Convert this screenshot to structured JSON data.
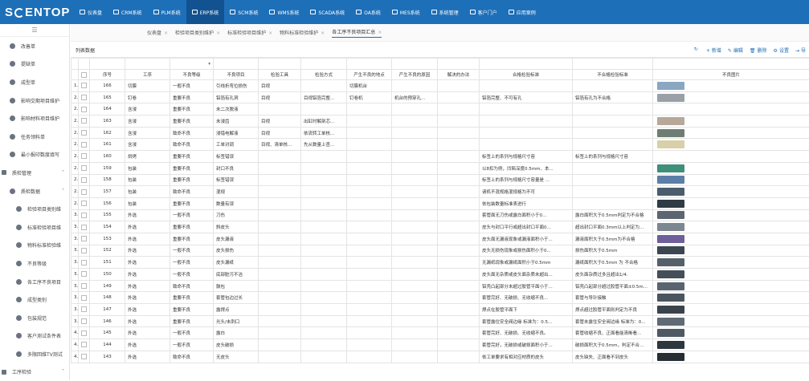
{
  "app": {
    "logo": "SCIENTOP"
  },
  "topnav": [
    {
      "label": "仪表盘",
      "active": false
    },
    {
      "label": "CRM系统",
      "active": false
    },
    {
      "label": "PLM系统",
      "active": false
    },
    {
      "label": "ERP系统",
      "active": true
    },
    {
      "label": "SCM系统",
      "active": false
    },
    {
      "label": "WMS系统",
      "active": false
    },
    {
      "label": "SCADA系统",
      "active": false
    },
    {
      "label": "OA系统",
      "active": false
    },
    {
      "label": "MES系统",
      "active": false
    },
    {
      "label": "系统管理",
      "active": false
    },
    {
      "label": "客户门户",
      "active": false
    },
    {
      "label": "应用案例",
      "active": false
    }
  ],
  "sidebar": {
    "items": [
      {
        "label": "改善单",
        "level": "lvl2"
      },
      {
        "label": "提缺单",
        "level": "lvl2"
      },
      {
        "label": "成型单",
        "level": "lvl2"
      },
      {
        "label": "影响交期项目维护",
        "level": "lvl2"
      },
      {
        "label": "影响材料项目维护",
        "level": "lvl2"
      },
      {
        "label": "任务领料单",
        "level": "lvl2"
      },
      {
        "label": "最小报印数度填写",
        "level": "lvl2"
      },
      {
        "label": "质检管理",
        "level": "lvl1",
        "arrow": "˅"
      },
      {
        "label": "质检数据",
        "level": "lvl2",
        "arrow": "˅"
      },
      {
        "label": "检验项目类别维",
        "level": "lvl3"
      },
      {
        "label": "标准检验项目维",
        "level": "lvl3"
      },
      {
        "label": "物料标准检验维",
        "level": "lvl3"
      },
      {
        "label": "不良等级",
        "level": "lvl3"
      },
      {
        "label": "各工序不良项目",
        "level": "lvl3"
      },
      {
        "label": "成型类别",
        "level": "lvl3"
      },
      {
        "label": "包装规范",
        "level": "lvl3"
      },
      {
        "label": "客户测试条件表",
        "level": "lvl3"
      },
      {
        "label": "多限回维TV测试",
        "level": "lvl3"
      },
      {
        "label": "工序检验",
        "level": "lvl1",
        "arrow": "˅"
      }
    ]
  },
  "tabs": [
    {
      "label": "仪表盘",
      "active": false
    },
    {
      "label": "检验项目类别维护",
      "active": false
    },
    {
      "label": "标准检验项目维护",
      "active": false
    },
    {
      "label": "物料标准检验维护",
      "active": false
    },
    {
      "label": "各工序不良项目汇总",
      "active": true
    }
  ],
  "panel": {
    "title": "列表数据",
    "tools": [
      {
        "icon": "↻",
        "label": ""
      },
      {
        "icon": "+",
        "label": "新增"
      },
      {
        "icon": "✎",
        "label": "编辑"
      },
      {
        "icon": "🗑",
        "label": "删除"
      },
      {
        "icon": "⚙",
        "label": "设置"
      },
      {
        "icon": "⇥",
        "label": "导"
      }
    ]
  },
  "table": {
    "columns": [
      "序号",
      "工序",
      "不良等级",
      "不良项目",
      "检验工具",
      "检验方式",
      "产生不良的地点",
      "产生不良的原因",
      "解决的办法",
      "合格检验标准",
      "不合格检验标准",
      "不良图片"
    ],
    "rows": [
      {
        "n": "19",
        "seq": "166",
        "proc": "切膜",
        "level": "一般不良",
        "item": "引线折弯位损伤",
        "tool": "目视",
        "method": "",
        "place": "切膜机台",
        "cause": "",
        "fix": "",
        "ok": "",
        "ng": "",
        "img": "#8aa6c1"
      },
      {
        "n": "20",
        "seq": "165",
        "proc": "钉卷",
        "level": "重要不良",
        "item": "铝箔有孔洞",
        "tool": "目视",
        "method": "目视铝箔完整...",
        "place": "钉卷机",
        "cause": "机台的预穿孔...",
        "fix": "",
        "ok": "铝箔完整、不可有孔",
        "ng": "铝箔有孔为不合格",
        "img": "#9aa0a6"
      },
      {
        "n": "21",
        "seq": "164",
        "proc": "含浸",
        "level": "重要不良",
        "item": "未二次脱液",
        "tool": "",
        "method": "",
        "place": "",
        "cause": "",
        "fix": "",
        "ok": "",
        "ng": "",
        "img": ""
      },
      {
        "n": "22",
        "seq": "163",
        "proc": "含浸",
        "level": "重要不良",
        "item": "未浸齿",
        "tool": "目视",
        "method": "出缸时解剖芯...",
        "place": "",
        "cause": "",
        "fix": "",
        "ok": "",
        "ng": "",
        "img": "#b7a89a"
      },
      {
        "n": "23",
        "seq": "162",
        "proc": "含浸",
        "level": "致命不良",
        "item": "浸错电解液",
        "tool": "目视",
        "method": "依流转工单核...",
        "place": "",
        "cause": "",
        "fix": "",
        "ok": "",
        "ng": "",
        "img": "#6f7e74",
        "sel": true
      },
      {
        "n": "24",
        "seq": "161",
        "proc": "含浸",
        "level": "致命不良",
        "item": "工单对调",
        "tool": "目视、清单核...",
        "method": "先从数量上查...",
        "place": "",
        "cause": "",
        "fix": "",
        "ok": "",
        "ng": "",
        "img": "#d9cfa8"
      },
      {
        "n": "25",
        "seq": "160",
        "proc": "烘烤",
        "level": "重要不良",
        "item": "标签错误",
        "tool": "",
        "method": "",
        "place": "",
        "cause": "",
        "fix": "",
        "ok": "标签上的系列与规格尺寸容",
        "ng": "标签上的系列与规格尺寸容",
        "img": ""
      },
      {
        "n": "26",
        "seq": "159",
        "proc": "包装",
        "level": "重要不良",
        "item": "封口不良",
        "tool": "",
        "method": "",
        "place": "",
        "cause": "",
        "fix": "",
        "ok": "以8扣为例，凹陷深度0.5mm、本...",
        "ng": "",
        "img": "#3f8f7a"
      },
      {
        "n": "27",
        "seq": "158",
        "proc": "包装",
        "level": "重要不良",
        "item": "标签错误",
        "tool": "",
        "method": "",
        "place": "",
        "cause": "",
        "fix": "",
        "ok": "标签上的系列与规格尺寸容量是 ...",
        "ng": "",
        "img": "#5b7fa8"
      },
      {
        "n": "28",
        "seq": "157",
        "proc": "包装",
        "level": "致命不良",
        "item": "混规",
        "tool": "",
        "method": "",
        "place": "",
        "cause": "",
        "fix": "",
        "ok": "请机不混规格混规格为不可",
        "ng": "",
        "img": "#4a5d6e"
      },
      {
        "n": "29",
        "seq": "156",
        "proc": "包装",
        "level": "重要不良",
        "item": "数量有误",
        "tool": "",
        "method": "",
        "place": "",
        "cause": "",
        "fix": "",
        "ok": "依包装数量标准表进行",
        "ng": "",
        "img": "#2f3b45"
      },
      {
        "n": "30",
        "seq": "155",
        "proc": "外选",
        "level": "一般不良",
        "item": "刀伤",
        "tool": "",
        "method": "",
        "place": "",
        "cause": "",
        "fix": "",
        "ok": "套管面无刀伤或露白面积小于0...",
        "ng": "露白面积大于0.5mm判定为不合格",
        "img": "#5c6670"
      },
      {
        "n": "31",
        "seq": "154",
        "proc": "外选",
        "level": "重要不良",
        "item": "斜皮头",
        "tool": "",
        "method": "",
        "place": "",
        "cause": "",
        "fix": "",
        "ok": "皮头与封口平行或超出封口平面0...",
        "ng": "超出封口平面0.3mm以上判定为...",
        "img": "#7d8792"
      },
      {
        "n": "32",
        "seq": "153",
        "proc": "外选",
        "level": "重要不良",
        "item": "皮头漏液",
        "tool": "",
        "method": "",
        "place": "",
        "cause": "",
        "fix": "",
        "ok": "皮头面无漏液现象或漏液面积小于...",
        "ng": "漏液面积大于0.5mm为不合格",
        "img": "#6d5f9a"
      },
      {
        "n": "33",
        "seq": "152",
        "proc": "外选",
        "level": "一般不良",
        "item": "皮头损伤",
        "tool": "",
        "method": "",
        "place": "",
        "cause": "",
        "fix": "",
        "ok": "皮头无损伤现象或损伤面积小于0...",
        "ng": "损伤面积大于0.5mm",
        "img": "#3c4650"
      },
      {
        "n": "34",
        "seq": "151",
        "proc": "外选",
        "level": "一般不良",
        "item": "皮头漏纸",
        "tool": "",
        "method": "",
        "place": "",
        "cause": "",
        "fix": "",
        "ok": "无漏纸现象或漏纸面积小于0.5mm",
        "ng": "漏纸面积大于0.5mm 为 不合格",
        "img": "#55606b"
      },
      {
        "n": "35",
        "seq": "150",
        "proc": "外选",
        "level": "一般不良",
        "item": "底部脏污不洁",
        "tool": "",
        "method": "",
        "place": "",
        "cause": "",
        "fix": "",
        "ok": "皮头面无杂质或皮头面杂质未超出...",
        "ng": "皮头面杂质过多且超出1/4.",
        "img": "#454f59"
      },
      {
        "n": "36",
        "seq": "149",
        "proc": "外选",
        "level": "致命不良",
        "item": "鼓包",
        "tool": "",
        "method": "",
        "place": "",
        "cause": "",
        "fix": "",
        "ok": "铝壳凸起部分未超过胶管平面小于...",
        "ng": "铝壳凸起部分超过胶管平面±0.5m...",
        "img": "#5a646e"
      },
      {
        "n": "37",
        "seq": "148",
        "proc": "外选",
        "level": "重要不良",
        "item": "套管包边过长",
        "tool": "",
        "method": "",
        "place": "",
        "cause": "",
        "fix": "",
        "ok": "套管完好、无破损、无收缩不良...",
        "ng": "套管与导针接触",
        "img": "#4b5560"
      },
      {
        "n": "38",
        "seq": "147",
        "proc": "外选",
        "level": "重要不良",
        "item": "露焊点",
        "tool": "",
        "method": "",
        "place": "",
        "cause": "",
        "fix": "",
        "ok": "焊点在胶管平面下",
        "ng": "焊点超过胶管平面则判定为不良",
        "img": "#3a434c"
      },
      {
        "n": "39",
        "seq": "146",
        "proc": "外选",
        "level": "重要不良",
        "item": "光头/未刺口",
        "tool": "",
        "method": "",
        "place": "",
        "cause": "",
        "fix": "",
        "ok": "套管露住安全阀边缘 标准为：0.5...",
        "ng": "套管未露住安全阀边缘 标准为：0...",
        "img": "#606a74"
      },
      {
        "n": "40",
        "seq": "145",
        "proc": "外选",
        "level": "一般不良",
        "item": "露白",
        "tool": "",
        "method": "",
        "place": "",
        "cause": "",
        "fix": "",
        "ok": "套管完好、无破损、无收缩不良。",
        "ng": "套管收缩不良、正面看能清晰看...",
        "img": "#4f5964"
      },
      {
        "n": "41",
        "seq": "144",
        "proc": "外选",
        "level": "一般不良",
        "item": "皮头破损",
        "tool": "",
        "method": "",
        "place": "",
        "cause": "",
        "fix": "",
        "ok": "套管完好，无破损或破损面积小于...",
        "ng": "破损面积大于0.5mm，判定不合...",
        "img": "#2e363e"
      },
      {
        "n": "42",
        "seq": "143",
        "proc": "外选",
        "level": "致命不良",
        "item": "无皮头",
        "tool": "",
        "method": "",
        "place": "",
        "cause": "",
        "fix": "",
        "ok": "依工单要求有相对应材质的皮头",
        "ng": "皮头缺失、正面看不到皮头",
        "img": "#252c33"
      }
    ]
  }
}
